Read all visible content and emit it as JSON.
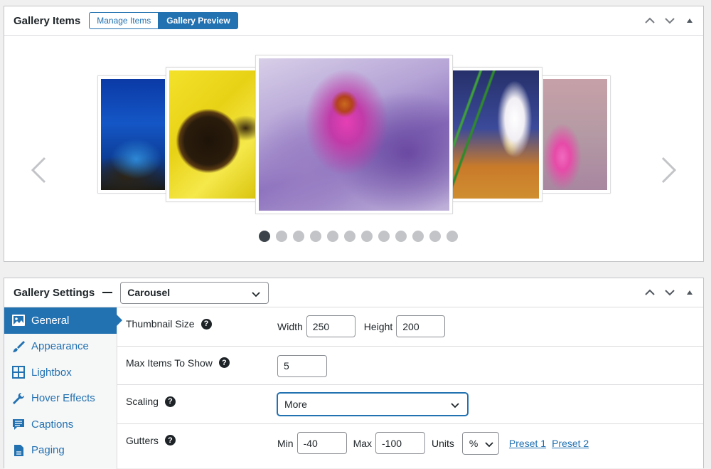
{
  "items_panel": {
    "title": "Gallery Items",
    "buttons": {
      "manage": "Manage Items",
      "preview": "Gallery Preview"
    },
    "carousel": {
      "slides": [
        {
          "subject": "blue-mushroom"
        },
        {
          "subject": "sunflower-bee"
        },
        {
          "subject": "purple-orchid"
        },
        {
          "subject": "white-flower"
        },
        {
          "subject": "pink-flower"
        }
      ],
      "dot_count": 12,
      "active_dot": 1
    }
  },
  "settings_panel": {
    "title": "Gallery Settings",
    "layout_value": "Carousel",
    "sidebar": [
      {
        "label": "General",
        "icon": "image-icon",
        "active": true
      },
      {
        "label": "Appearance",
        "icon": "brush-icon",
        "active": false
      },
      {
        "label": "Lightbox",
        "icon": "grid-icon",
        "active": false
      },
      {
        "label": "Hover Effects",
        "icon": "wrench-icon",
        "active": false
      },
      {
        "label": "Captions",
        "icon": "comment-icon",
        "active": false
      },
      {
        "label": "Paging",
        "icon": "page-icon",
        "active": false
      }
    ],
    "rows": {
      "thumbnail": {
        "label": "Thumbnail Size",
        "width_label": "Width",
        "width_value": "250",
        "height_label": "Height",
        "height_value": "200"
      },
      "max_items": {
        "label": "Max Items To Show",
        "value": "5"
      },
      "scaling": {
        "label": "Scaling",
        "value": "More"
      },
      "gutters": {
        "label": "Gutters",
        "min_label": "Min",
        "min_value": "-40",
        "max_label": "Max",
        "max_value": "-100",
        "units_label": "Units",
        "units_value": "%",
        "preset1": "Preset 1",
        "preset2": "Preset 2"
      }
    },
    "help_glyph": "?"
  },
  "colors": {
    "accent": "#2271b1",
    "border": "#c3c4c7",
    "text": "#1d2327",
    "muted": "#787c82"
  }
}
